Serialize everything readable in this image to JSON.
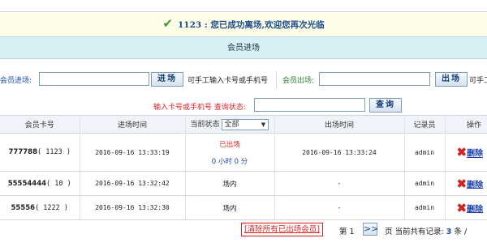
{
  "notice": {
    "message": "1123 : 您已成功离场,欢迎您再次光临",
    "icon": "check-icon"
  },
  "section": {
    "title": "会员进场"
  },
  "entry": {
    "in_label": "会员进场:",
    "in_button": "进场",
    "in_hint": "可手工输入卡号或手机号",
    "out_label": "会员出场:",
    "out_button": "出场",
    "out_hint": "可手工"
  },
  "query": {
    "label": "输入卡号或手机号 查询状态:",
    "button": "查询"
  },
  "table": {
    "headers": [
      "会员卡号",
      "进场时间",
      "当前状态",
      "出场时间",
      "记录员",
      "操作"
    ],
    "status_filter": "全部",
    "rows": [
      {
        "card": "777788",
        "id": "( 1123 )",
        "in_time": "2016-09-16 13:33:19",
        "status": "已出场",
        "duration": "0 小时 0 分",
        "out_time": "2016-09-16 13:33:24",
        "recorder": "admin",
        "action": "删除"
      },
      {
        "card": "55554444",
        "id": "( 10 )",
        "in_time": "2016-09-16 13:32:42",
        "status": "场内",
        "duration": "",
        "out_time": "-",
        "recorder": "admin",
        "action": "删除"
      },
      {
        "card": "55556",
        "id": "( 1222 )",
        "in_time": "2016-09-16 13:32:30",
        "status": "场内",
        "duration": "",
        "out_time": "-",
        "recorder": "admin",
        "action": "删除"
      }
    ]
  },
  "footer": {
    "clear_button": "[清除所有已出场会员]",
    "page_label": "第 1",
    "next_button": ">>",
    "total_prefix": "页 当前共有记录:",
    "total_count": "3",
    "total_suffix": "条 /"
  },
  "colors": {
    "accent": "#1a4aa6",
    "alert": "#d22222",
    "header_bg": "#d6f0f4",
    "notice_bg": "#fdfde8"
  }
}
